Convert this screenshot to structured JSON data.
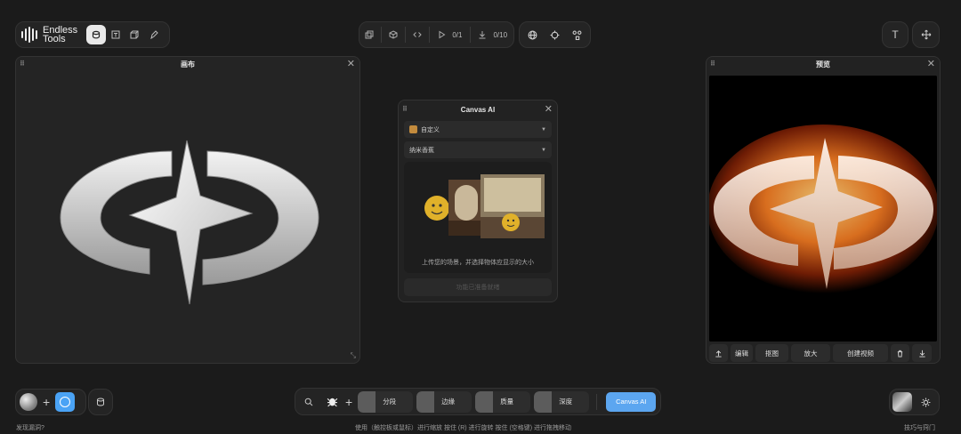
{
  "brand": {
    "name_line1": "Endless",
    "name_line2": "Tools"
  },
  "top_toolbar": {
    "mode_icons": [
      "layers-icon",
      "text-box-icon",
      "cube-icon",
      "brush-icon"
    ],
    "center_icons": [
      "copy-icon",
      "box-icon",
      "code-icon",
      "play-icon",
      "download-icon"
    ],
    "run_counter": "0/1",
    "download_counter": "0/10",
    "view_icons": [
      "globe-icon",
      "target-icon",
      "nodes-icon"
    ],
    "right_icons": [
      "text-icon",
      "move-icon"
    ]
  },
  "canvas_panel": {
    "title": "画布"
  },
  "canvas_ai": {
    "title": "Canvas AI",
    "style_select": "自定义",
    "model_select": "纳米香蕉",
    "upload_hint": "上传您的场景，并选择物体应显示的大小",
    "apply_label": "功能已准备就绪"
  },
  "preview_panel": {
    "title": "预览",
    "actions": {
      "edit": "编辑",
      "cutout": "抠图",
      "upscale": "放大",
      "create_video": "创建视频"
    }
  },
  "bottom_toolbar": {
    "tools": [
      {
        "label": "分段"
      },
      {
        "label": "边缘"
      },
      {
        "label": "质量"
      },
      {
        "label": "深度"
      }
    ],
    "canvas_ai_button": "Canvas AI"
  },
  "status_bar": {
    "left": "发现漏洞?",
    "center": "使用（触控板或鼠标）进行缩放    按住 (R) 进行旋转    按住 (空格键) 进行拖拽移动",
    "right": "技巧与窍门"
  },
  "colors": {
    "accent": "#5ca6f0",
    "background": "#1b1b1b",
    "panel": "#222222"
  }
}
